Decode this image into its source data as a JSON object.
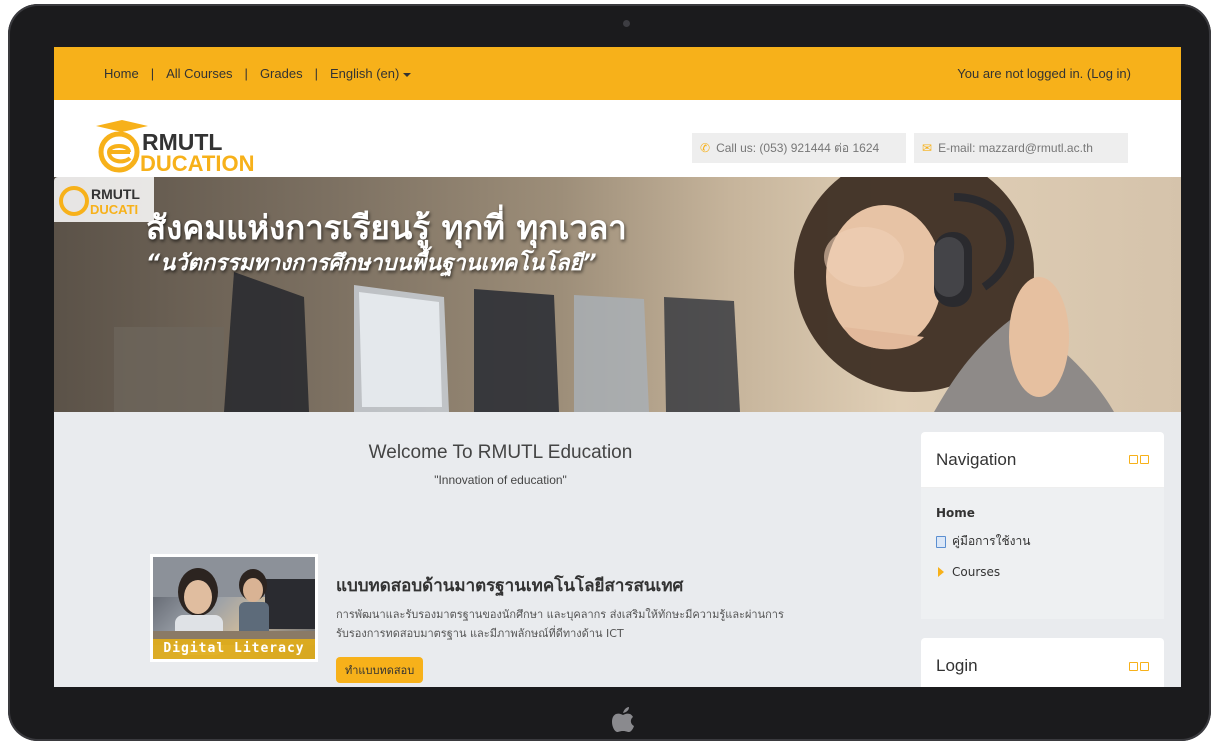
{
  "topbar": {
    "nav": [
      "Home",
      "All Courses",
      "Grades",
      "English (en)"
    ],
    "login_status": "You are not logged in. (Log in)"
  },
  "header": {
    "logo_text_1": "RMUTL",
    "logo_text_2": "DUCATION",
    "phone": "Call us: (053) 921444 ต่อ 1624",
    "email": "E-mail: mazzard@rmutl.ac.th"
  },
  "banner": {
    "title": "สังคมแห่งการเรียนรู้ ทุกที่ ทุกเวลา",
    "subtitle": "“นวัตกรรมทางการศึกษาบนพื้นฐานเทคโนโลยี”",
    "logo_text_1": "RMUTL",
    "logo_text_2": "DUCATI"
  },
  "content": {
    "welcome": "Welcome To RMUTL Education",
    "tagline": "\"Innovation of education\"",
    "course": {
      "image_label": "Digital Literacy",
      "title": "แบบทดสอบด้านมาตรฐานเทคโนโลยีสารสนเทศ",
      "description_1": "การพัฒนาและรับรองมาตรฐานของนักศึกษา และบุคลากร ส่งเสริมให้ทักษะมีความรู้และผ่านการ",
      "description_2": "รับรองการทดสอบมาตรฐาน และมีภาพลักษณ์ที่ดีทางด้าน ICT",
      "button": "ทำแบบทดสอบ"
    }
  },
  "sidebar": {
    "navigation": {
      "title": "Navigation",
      "home": "Home",
      "items": [
        "คู่มือการใช้งาน",
        "Courses"
      ]
    },
    "login": {
      "title": "Login"
    }
  },
  "colors": {
    "accent": "#f7b11a",
    "background": "#e9ebee",
    "text": "#333333"
  }
}
